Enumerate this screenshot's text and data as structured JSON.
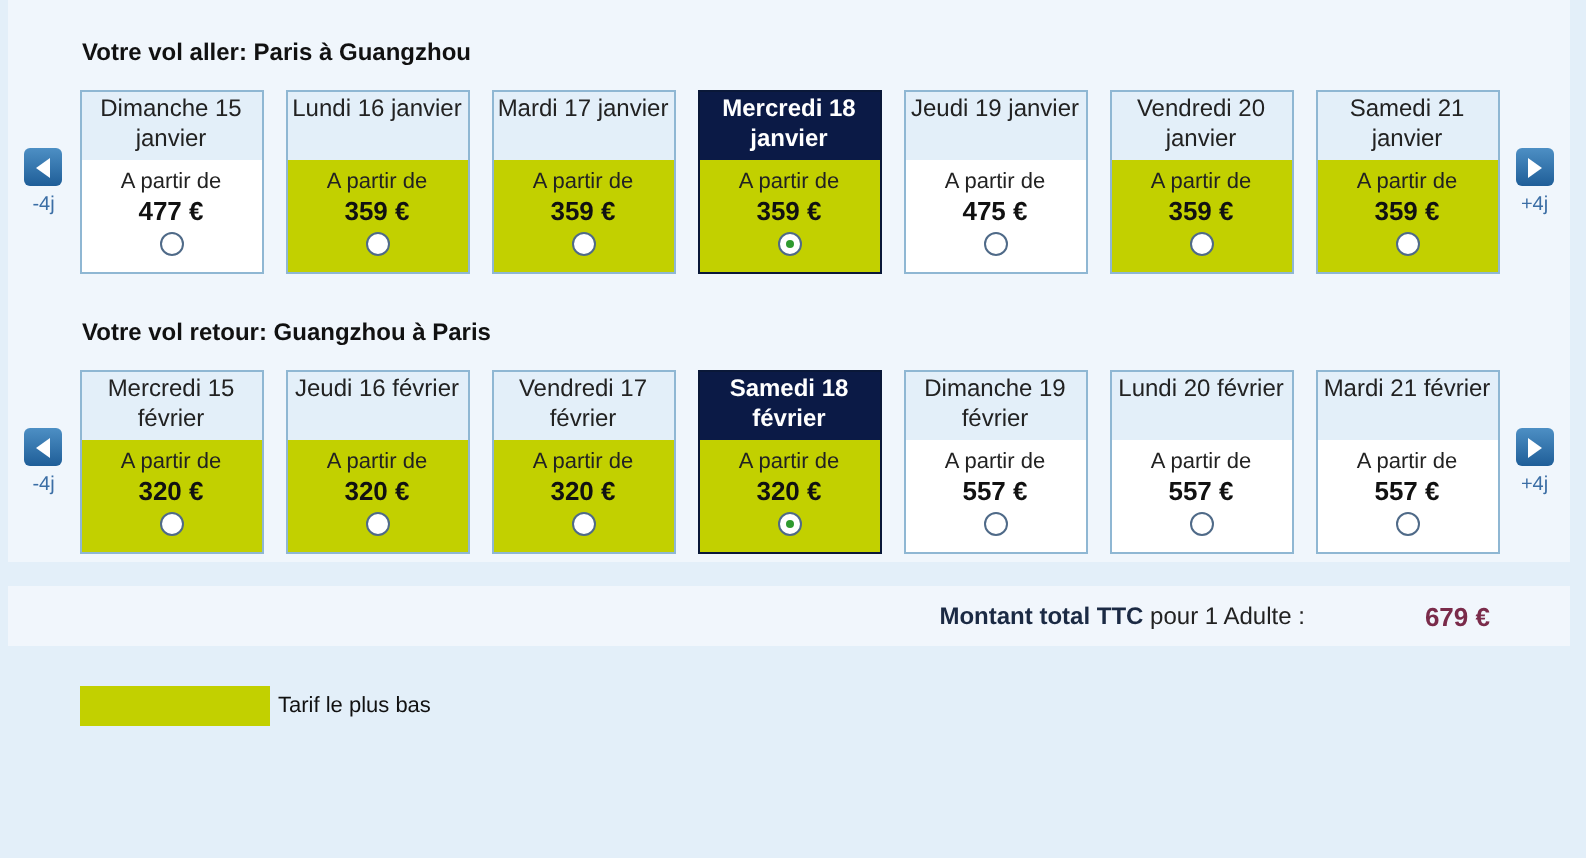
{
  "legs": [
    {
      "title": "Votre vol aller: Paris à Guangzhou",
      "prev_label": "-4j",
      "next_label": "+4j",
      "days": [
        {
          "date": "Dimanche 15 janvier",
          "from": "A partir de",
          "price": "477 €",
          "lowest": false,
          "selected": false
        },
        {
          "date": "Lundi 16 janvier",
          "from": "A partir de",
          "price": "359 €",
          "lowest": true,
          "selected": false
        },
        {
          "date": "Mardi 17 janvier",
          "from": "A partir de",
          "price": "359 €",
          "lowest": true,
          "selected": false
        },
        {
          "date": "Mercredi 18 janvier",
          "from": "A partir de",
          "price": "359 €",
          "lowest": true,
          "selected": true
        },
        {
          "date": "Jeudi 19 janvier",
          "from": "A partir de",
          "price": "475 €",
          "lowest": false,
          "selected": false
        },
        {
          "date": "Vendredi 20 janvier",
          "from": "A partir de",
          "price": "359 €",
          "lowest": true,
          "selected": false
        },
        {
          "date": "Samedi 21 janvier",
          "from": "A partir de",
          "price": "359 €",
          "lowest": true,
          "selected": false
        }
      ]
    },
    {
      "title": "Votre vol retour: Guangzhou à Paris",
      "prev_label": "-4j",
      "next_label": "+4j",
      "days": [
        {
          "date": "Mercredi 15 février",
          "from": "A partir de",
          "price": "320 €",
          "lowest": true,
          "selected": false
        },
        {
          "date": "Jeudi 16 février",
          "from": "A partir de",
          "price": "320 €",
          "lowest": true,
          "selected": false
        },
        {
          "date": "Vendredi 17 février",
          "from": "A partir de",
          "price": "320 €",
          "lowest": true,
          "selected": false
        },
        {
          "date": "Samedi 18 février",
          "from": "A partir de",
          "price": "320 €",
          "lowest": true,
          "selected": true
        },
        {
          "date": "Dimanche 19 février",
          "from": "A partir de",
          "price": "557 €",
          "lowest": false,
          "selected": false
        },
        {
          "date": "Lundi 20 février",
          "from": "A partir de",
          "price": "557 €",
          "lowest": false,
          "selected": false
        },
        {
          "date": "Mardi 21 février",
          "from": "A partir de",
          "price": "557 €",
          "lowest": false,
          "selected": false
        }
      ]
    }
  ],
  "total": {
    "label": "**Montant total TTC** pour 1 Adulte :",
    "amount": "679 €"
  },
  "legend": {
    "label": "Tarif le plus bas"
  }
}
